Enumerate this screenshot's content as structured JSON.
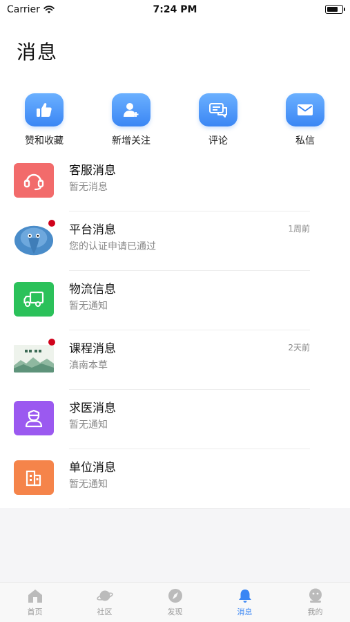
{
  "status_bar": {
    "carrier": "Carrier",
    "time": "7:24 PM",
    "battery_level": 0.75
  },
  "page": {
    "title": "消息"
  },
  "quick_actions": [
    {
      "label": "赞和收藏",
      "icon": "thumbs-up-icon"
    },
    {
      "label": "新增关注",
      "icon": "add-user-icon"
    },
    {
      "label": "评论",
      "icon": "comment-icon"
    },
    {
      "label": "私信",
      "icon": "mail-icon"
    }
  ],
  "messages": [
    {
      "title": "客服消息",
      "subtitle": "暂无消息",
      "time": "",
      "icon": "headset-icon",
      "color": "#f26b6b",
      "unread": false
    },
    {
      "title": "平台消息",
      "subtitle": "您的认证申请已通过",
      "time": "1周前",
      "icon": "platform-avatar",
      "color": "#4a8cc9",
      "unread": true
    },
    {
      "title": "物流信息",
      "subtitle": "暂无通知",
      "time": "",
      "icon": "truck-icon",
      "color": "#2bc15a",
      "unread": false
    },
    {
      "title": "课程消息",
      "subtitle": "滇南本草",
      "time": "2天前",
      "icon": "course-thumbnail",
      "color": "#8fb8a0",
      "unread": true
    },
    {
      "title": "求医消息",
      "subtitle": "暂无通知",
      "time": "",
      "icon": "doctor-icon",
      "color": "#9b59f0",
      "unread": false
    },
    {
      "title": "单位消息",
      "subtitle": "暂无通知",
      "time": "",
      "icon": "building-icon",
      "color": "#f5844a",
      "unread": false
    }
  ],
  "tab_bar": [
    {
      "label": "首页",
      "icon": "home-icon",
      "active": false
    },
    {
      "label": "社区",
      "icon": "planet-icon",
      "active": false
    },
    {
      "label": "发现",
      "icon": "compass-icon",
      "active": false
    },
    {
      "label": "消息",
      "icon": "bell-icon",
      "active": true
    },
    {
      "label": "我的",
      "icon": "profile-icon",
      "active": false
    }
  ],
  "colors": {
    "accent": "#3a86f4",
    "inactive_tab": "#bbbbbb",
    "unread_dot": "#d0021b"
  }
}
